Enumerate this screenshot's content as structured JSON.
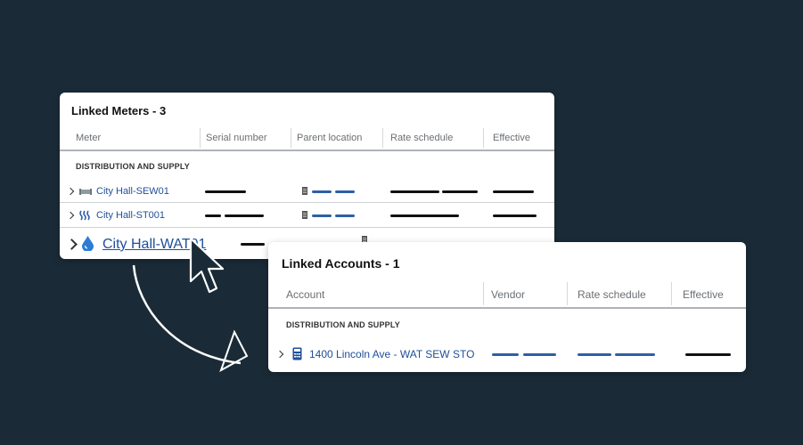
{
  "meters_card": {
    "title": "Linked Meters - 3",
    "columns": [
      "Meter",
      "Serial number",
      "Parent location",
      "Rate schedule",
      "Effective"
    ],
    "section": "DISTRIBUTION AND SUPPLY",
    "rows": [
      {
        "label": "City Hall-SEW01",
        "icon": "sewer-pipe-icon"
      },
      {
        "label": "City Hall-ST001",
        "icon": "steam-icon"
      },
      {
        "label": "City Hall-WAT01",
        "icon": "water-drop-icon"
      }
    ]
  },
  "accounts_card": {
    "title": "Linked Accounts - 1",
    "columns": [
      "Account",
      "Vendor",
      "Rate schedule",
      "Effective"
    ],
    "section": "DISTRIBUTION AND SUPPLY",
    "rows": [
      {
        "label": "1400 Lincoln Ave - WAT SEW STO",
        "icon": "calculator-icon"
      }
    ]
  },
  "colors": {
    "background": "#1a2b37",
    "link": "#1f4f9a",
    "placeholder_blue": "#2e5fa6"
  }
}
